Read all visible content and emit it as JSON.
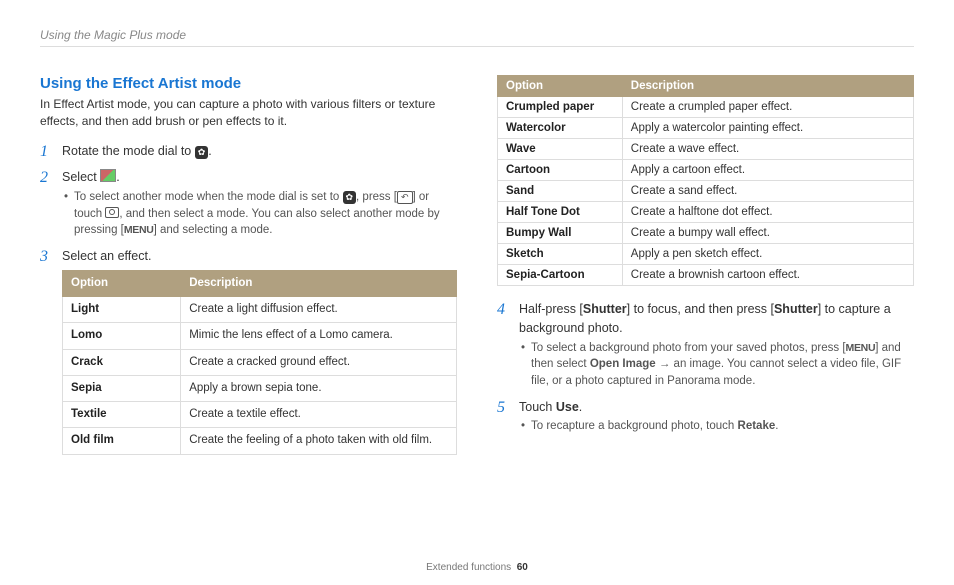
{
  "breadcrumb": "Using the Magic Plus mode",
  "section_title": "Using the Effect Artist mode",
  "intro": "In Effect Artist mode, you can capture a photo with various filters or texture effects, and then add brush or pen effects to it.",
  "steps": {
    "s1_pre": "Rotate the mode dial to ",
    "s1_post": ".",
    "s2_pre": "Select ",
    "s2_post": ".",
    "s2_b1_a": "To select another mode when the mode dial is set to ",
    "s2_b1_b": ", press [",
    "s2_b1_c": "] or touch ",
    "s2_b1_d": ", and then select a mode. You can also select another mode by pressing [",
    "s2_b1_e": "] and selecting a mode.",
    "s3": "Select an effect.",
    "s4_a": "Half-press [",
    "s4_b": "] to focus, and then press [",
    "s4_c": "] to capture a background photo.",
    "s4_shutter": "Shutter",
    "s4_b1_a": "To select a background photo from your saved photos, press [",
    "s4_b1_b": "] and then select ",
    "s4_b1_open": "Open Image",
    "s4_b1_c": " → an image. You cannot select a video file, GIF file, or a photo captured in Panorama mode.",
    "s5_a": "Touch ",
    "s5_use": "Use",
    "s5_b": ".",
    "s5_b1_a": "To recapture a background photo, touch ",
    "s5_b1_retake": "Retake",
    "s5_b1_b": "."
  },
  "menu_label": "MENU",
  "table_headers": {
    "opt": "Option",
    "desc": "Description"
  },
  "table1": [
    {
      "o": "Light",
      "d": "Create a light diffusion effect."
    },
    {
      "o": "Lomo",
      "d": "Mimic the lens effect of a Lomo camera."
    },
    {
      "o": "Crack",
      "d": "Create a cracked ground effect."
    },
    {
      "o": "Sepia",
      "d": "Apply a brown sepia tone."
    },
    {
      "o": "Textile",
      "d": "Create a textile effect."
    },
    {
      "o": "Old film",
      "d": "Create the feeling of a photo taken with old film."
    }
  ],
  "table2": [
    {
      "o": "Crumpled paper",
      "d": "Create a crumpled paper effect."
    },
    {
      "o": "Watercolor",
      "d": "Apply a watercolor painting effect."
    },
    {
      "o": "Wave",
      "d": "Create a wave effect."
    },
    {
      "o": "Cartoon",
      "d": "Apply a cartoon effect."
    },
    {
      "o": "Sand",
      "d": "Create a sand effect."
    },
    {
      "o": "Half Tone Dot",
      "d": "Create a halftone dot effect."
    },
    {
      "o": "Bumpy Wall",
      "d": "Create a bumpy wall effect."
    },
    {
      "o": "Sketch",
      "d": "Apply a pen sketch effect."
    },
    {
      "o": "Sepia-Cartoon",
      "d": "Create a brownish cartoon effect."
    }
  ],
  "footer_label": "Extended functions",
  "footer_page": "60"
}
